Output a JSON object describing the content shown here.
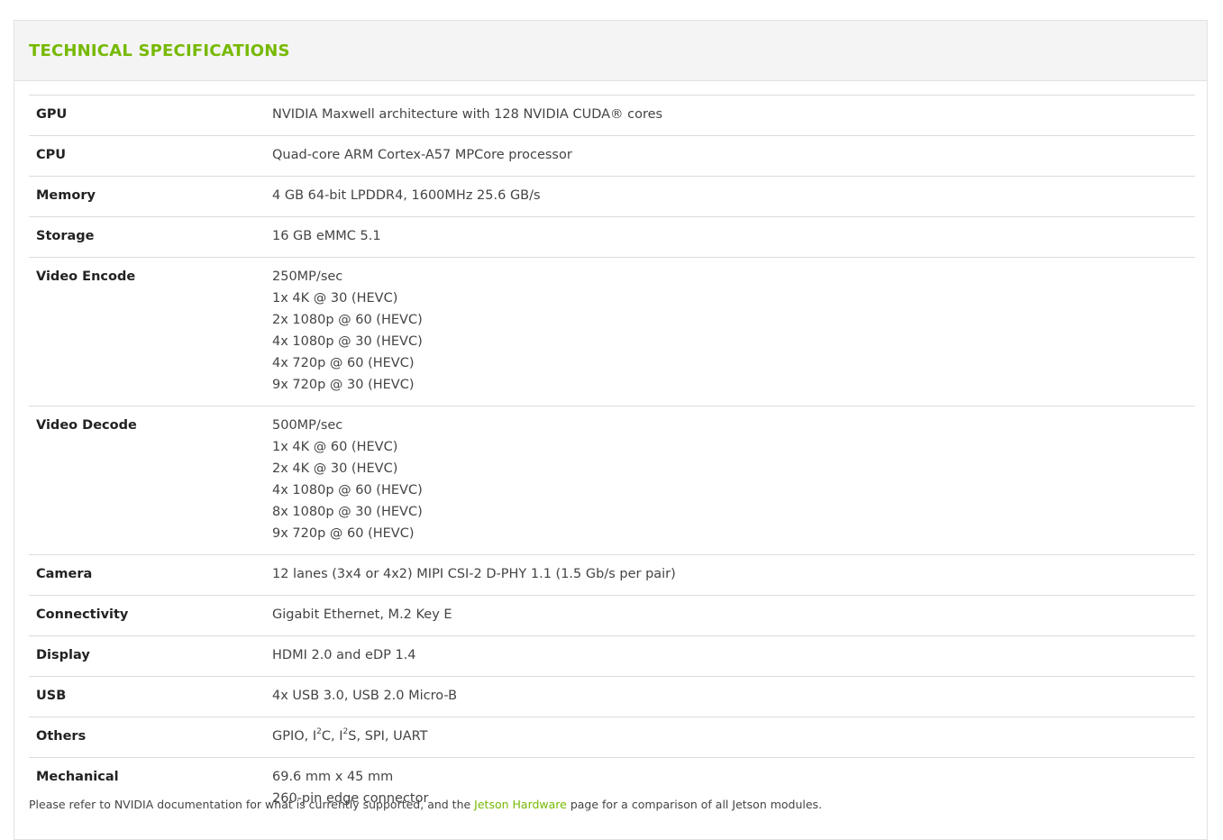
{
  "section": {
    "title": "TECHNICAL SPECIFICATIONS"
  },
  "specs": [
    {
      "label": "GPU",
      "lines": [
        "NVIDIA Maxwell architecture with 128 NVIDIA CUDA® cores"
      ]
    },
    {
      "label": "CPU",
      "lines": [
        "Quad-core ARM Cortex-A57 MPCore processor"
      ]
    },
    {
      "label": "Memory",
      "lines": [
        "4 GB 64-bit LPDDR4, 1600MHz 25.6 GB/s"
      ]
    },
    {
      "label": "Storage",
      "lines": [
        "16 GB eMMC 5.1"
      ]
    },
    {
      "label": "Video Encode",
      "lines": [
        "250MP/sec",
        "1x 4K @ 30 (HEVC)",
        "2x 1080p @ 60 (HEVC)",
        "4x 1080p @ 30 (HEVC)",
        "4x 720p @ 60 (HEVC)",
        "9x 720p @ 30 (HEVC)"
      ]
    },
    {
      "label": "Video Decode",
      "lines": [
        "500MP/sec",
        "1x 4K @ 60 (HEVC)",
        "2x 4K @ 30 (HEVC)",
        "4x 1080p @ 60 (HEVC)",
        "8x 1080p @ 30 (HEVC)",
        "9x 720p @ 60 (HEVC)"
      ]
    },
    {
      "label": "Camera",
      "lines": [
        "12 lanes (3x4 or 4x2) MIPI CSI-2 D-PHY 1.1 (1.5 Gb/s per pair)"
      ]
    },
    {
      "label": "Connectivity",
      "lines": [
        "Gigabit Ethernet, M.2 Key E"
      ]
    },
    {
      "label": "Display",
      "lines": [
        "HDMI 2.0 and eDP 1.4"
      ]
    },
    {
      "label": "USB",
      "lines": [
        "4x USB 3.0, USB 2.0 Micro-B"
      ]
    },
    {
      "label": "Others",
      "parts": [
        "GPIO, I",
        "2",
        "C, I",
        "2",
        "S, SPI, UART"
      ]
    },
    {
      "label": "Mechanical",
      "lines": [
        "69.6 mm x 45 mm",
        "260-pin edge connector"
      ]
    }
  ],
  "footnote": {
    "before": "Please refer to NVIDIA documentation for what is currently supported, and the ",
    "link": "Jetson Hardware",
    "after": " page for a comparison of all Jetson modules."
  },
  "colors": {
    "accent": "#76b900"
  }
}
